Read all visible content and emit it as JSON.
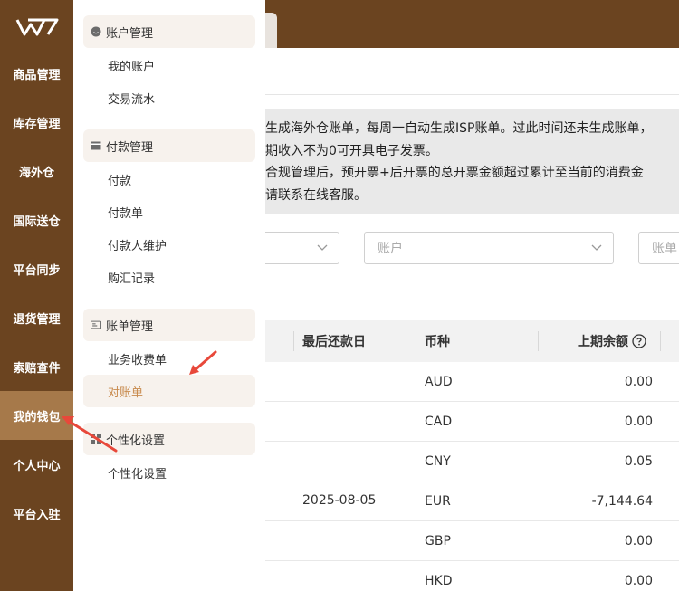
{
  "sidebar": {
    "items": [
      {
        "label": "商品管理"
      },
      {
        "label": "库存管理"
      },
      {
        "label": "海外仓"
      },
      {
        "label": "国际送仓"
      },
      {
        "label": "平台同步"
      },
      {
        "label": "退货管理"
      },
      {
        "label": "索赔查件"
      },
      {
        "label": "我的钱包"
      },
      {
        "label": "个人中心"
      },
      {
        "label": "平台入驻"
      }
    ]
  },
  "submenu": {
    "groups": [
      {
        "title": "账户管理",
        "icon": "smile-icon",
        "items": [
          "我的账户",
          "交易流水"
        ]
      },
      {
        "title": "付款管理",
        "icon": "card-icon",
        "items": [
          "付款",
          "付款单",
          "付款人维护",
          "购汇记录"
        ]
      },
      {
        "title": "账单管理",
        "icon": "bill-icon",
        "items": [
          "业务收费单",
          "对账单"
        ]
      },
      {
        "title": "个性化设置",
        "icon": "grid-icon",
        "items": [
          "个性化设置"
        ]
      }
    ]
  },
  "notice": {
    "lines": [
      "生成海外仓账单，每周一自动生成ISP账单。过此时间还未生成账单，",
      "期收入不为0可开具电子发票。",
      "合规管理后，预开票+后开票的总开票金额超过累计至当前的消费金",
      "请联系在线客服。"
    ]
  },
  "filters": {
    "account_placeholder": "账户",
    "third_placeholder": "账单"
  },
  "table": {
    "headers": {
      "last_payment": "最后还款日",
      "currency": "币种",
      "prev_balance": "上期余额"
    },
    "date": "2025-08-05",
    "rows": [
      {
        "currency": "AUD",
        "balance": "0.00"
      },
      {
        "currency": "CAD",
        "balance": "0.00"
      },
      {
        "currency": "CNY",
        "balance": "0.05"
      },
      {
        "currency": "EUR",
        "balance": "-7,144.64"
      },
      {
        "currency": "GBP",
        "balance": "0.00"
      },
      {
        "currency": "HKD",
        "balance": "0.00"
      }
    ]
  },
  "colors": {
    "sidebar": "#6b4420",
    "active": "#a6794a",
    "accent": "#c88a4d",
    "arrow": "#e8483a"
  }
}
